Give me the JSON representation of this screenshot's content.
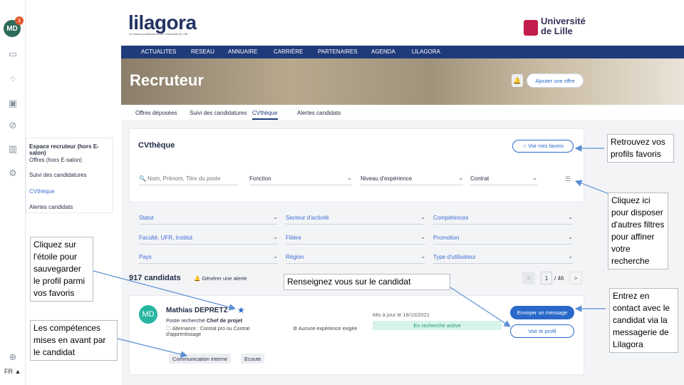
{
  "rail": {
    "avatar_initials": "MD",
    "badge_count": "3",
    "language": "FR ▲"
  },
  "submenu": {
    "items": [
      {
        "label": "Espace recruteur (hors E-salon)"
      },
      {
        "label": "Offres (hors E-salon)"
      },
      {
        "label": "Suivi des candidatures"
      },
      {
        "label": "CVthèque"
      },
      {
        "label": "Alertes candidats"
      }
    ]
  },
  "header": {
    "logo": "lilagora",
    "logo_tagline": "Le réseau professionnel de l'Université de Lille",
    "university": "Université de Lille"
  },
  "nav": {
    "items": [
      "ACTUALITES",
      "RESEAU",
      "ANNUAIRE",
      "CARRIÈRE",
      "PARTENAIRES",
      "AGENDA",
      "LILAGORA"
    ]
  },
  "banner": {
    "title": "Recruteur",
    "add_offer_label": "Ajouter une offre"
  },
  "tabs": [
    "Offres déposées",
    "Suivi des candidatures",
    "CVthèque",
    "Alertes candidats"
  ],
  "cvtheque": {
    "title": "CVthèque",
    "favorites_label": "☆ Voir mes favoris",
    "search_placeholder": "🔍 Nom, Prénom, Titre du poste",
    "filters_row1": [
      "Fonction",
      "Niveau d'expérience",
      "Contrat"
    ],
    "filters_more": [
      [
        "Statut",
        "Secteur d'activité",
        "Compétences"
      ],
      [
        "Faculté, UFR, Institut",
        "Filière",
        "Promotion"
      ],
      [
        "Pays",
        "Région",
        "Type d'utilisateur"
      ]
    ],
    "count": "917 candidats",
    "alert_label": "🔔 Générer une alerte",
    "pager": {
      "prev": "<",
      "current": "1",
      "total": "/ 46",
      "next": ">"
    }
  },
  "candidate": {
    "initials": "MD",
    "name": "Mathias DEPRETZ",
    "poste_label": "Poste recherché",
    "poste_value": "Chef de projet",
    "contract": "Alternance : Contrat pro ou Contrat d'apprentissage",
    "experience": "Aucune expérience exigée",
    "updated": "Mis à jour le 18/10/2021",
    "status": "En recherche active",
    "message_button": "Envoyer un message",
    "profile_button": "Voir le profil",
    "skills": [
      "Communication interne",
      "Ecoute"
    ]
  },
  "callouts": {
    "favorites": "Retrouvez vos profils favoris",
    "filters": "Cliquez ici pour disposer d'autres filtres pour affiner votre recherche",
    "star": "Cliquez sur l'étoile pour sauvegarder le profil parmi vos favoris",
    "skills": "Les compétences mises en avant par le candidat",
    "info": "Renseignez vous sur le candidat",
    "contact": "Entrez en contact avec le candidat via la messagerie de Lilagora"
  },
  "colors": {
    "nav_blue": "#1f3b7a",
    "accent_blue": "#2a69c9",
    "status_green_bg": "#d7f3ea",
    "university_red": "#c21e4b"
  }
}
